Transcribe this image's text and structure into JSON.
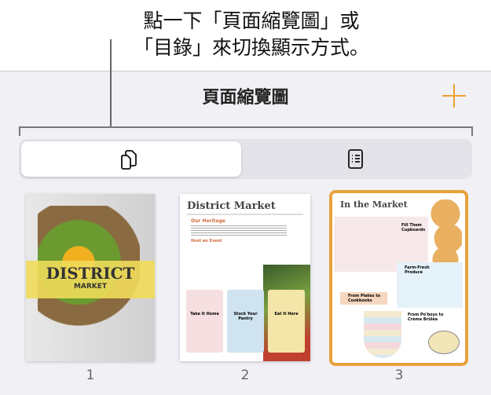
{
  "callout": {
    "line1": "點一下「頁面縮覽圖」或",
    "line2": "「目錄」來切換顯示方式。"
  },
  "panel": {
    "title": "頁面縮覽圖",
    "add_icon": "plus-icon",
    "accent": "#f0a030"
  },
  "view_toggle": {
    "selected": "page-thumbnails",
    "options": [
      {
        "icon": "pages-icon"
      },
      {
        "icon": "toc-icon"
      }
    ]
  },
  "pages": [
    {
      "number": "1",
      "cover_title": "DISTRICT",
      "cover_sub": "MARKET"
    },
    {
      "number": "2",
      "heading": "District Market",
      "sub1": "Our Heritage",
      "sub2": "Host an Event",
      "cards": [
        "Take It Home",
        "Stock Your Pantry",
        "Eat It Here"
      ]
    },
    {
      "number": "3",
      "heading": "In the Market",
      "items": [
        "Fill Them Cupboards",
        "Farm-Fresh Produce",
        "From Plates to Cookbooks",
        "From Po'boys to Crème Brûlée"
      ],
      "selected": true
    }
  ]
}
